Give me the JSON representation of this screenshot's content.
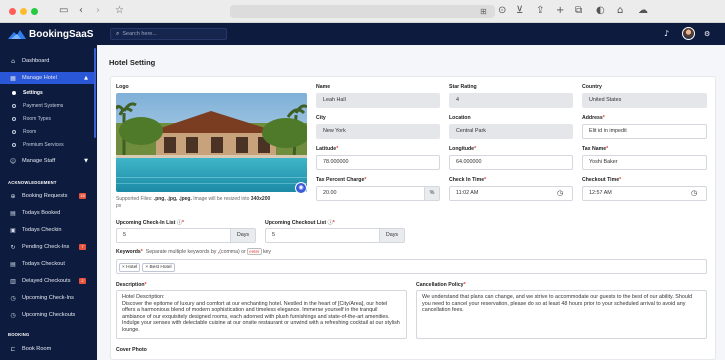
{
  "browser": {
    "icons": [
      "sidebar-toggle-icon",
      "back-icon",
      "forward-icon",
      "bookmark-star-icon",
      "translate-icon",
      "play-circle-icon",
      "download-icon",
      "share-icon",
      "new-tab-icon",
      "tabs-overview-icon",
      "shield-icon",
      "home-icon",
      "cloud-icon"
    ]
  },
  "header": {
    "brand": "BookingSaaS",
    "search_placeholder": "Search here...",
    "icons": [
      "bell-icon",
      "avatar",
      "gear-icon"
    ]
  },
  "sidebar": {
    "items": [
      {
        "icon": "home-icon",
        "label": "Dashboard"
      },
      {
        "icon": "building-icon",
        "label": "Manage Hotel"
      },
      {
        "icon": "users-icon",
        "label": "Manage Staff"
      },
      {
        "icon": "cart-icon",
        "label": "Booking Requests",
        "badge": "18"
      },
      {
        "icon": "calendar-icon",
        "label": "Todays Booked"
      },
      {
        "icon": "calendar-check-icon",
        "label": "Todays Checkin"
      },
      {
        "icon": "refresh-icon",
        "label": "Pending Check-Ins",
        "badge": "7"
      },
      {
        "icon": "calendar-icon",
        "label": "Todays Checkout"
      },
      {
        "icon": "calendar-x-icon",
        "label": "Delayed Checkouts",
        "badge": "2"
      },
      {
        "icon": "clock-icon",
        "label": "Upcoming Check-Ins"
      },
      {
        "icon": "clock-icon",
        "label": "Upcoming Checkouts"
      },
      {
        "icon": "door-icon",
        "label": "Book Room"
      }
    ],
    "submenu": [
      "Settings",
      "Payment Systems",
      "Room Types",
      "Room",
      "Premium Services"
    ],
    "sections": [
      "ACKNOWLEDGEMENT",
      "BOOKING"
    ]
  },
  "page": {
    "title": "Hotel Setting"
  },
  "form": {
    "logo_label": "Logo",
    "logo_hint_prefix": "Supported Files: ",
    "logo_hint_types": ".png, .jpg, .jpeg.",
    "logo_hint_mid": " Image will be resized into ",
    "logo_hint_size": "340x200",
    "logo_hint_suffix": "px",
    "name": {
      "label": "Name",
      "value": "Leah Hall"
    },
    "star_rating": {
      "label": "Star Rating",
      "value": "4"
    },
    "country": {
      "label": "Country",
      "value": "United States"
    },
    "city": {
      "label": "City",
      "value": "New York"
    },
    "location": {
      "label": "Location",
      "value": "Central Park"
    },
    "address": {
      "label": "Address",
      "value": "Elit id in impedit"
    },
    "latitude": {
      "label": "Latitude",
      "value": "78.000000"
    },
    "longitude": {
      "label": "Longitude",
      "value": "64.000000"
    },
    "tax_name": {
      "label": "Tax Name",
      "value": "Yoshi Baker"
    },
    "tax_percent": {
      "label": "Tax Percent Charge",
      "value": "20.00",
      "addon": "%"
    },
    "check_in_time": {
      "label": "Check In Time",
      "value": "11:02 AM"
    },
    "checkout_time": {
      "label": "Checkout Time",
      "value": "12:57 AM"
    },
    "upcoming_checkin": {
      "label": "Upcoming Check-In List",
      "value": "5",
      "addon": "Days"
    },
    "upcoming_checkout": {
      "label": "Upcoming Checkout List",
      "value": "5",
      "addon": "Days"
    },
    "keywords": {
      "label": "Keywords",
      "hint_a": "Separate multiple keywords by ",
      "hint_comma": ",",
      "hint_b": "(comma) or ",
      "hint_key": "enter",
      "hint_c": " key",
      "chips": [
        "Hotel",
        "Best Hotel"
      ]
    },
    "description": {
      "label": "Description",
      "value": "Hotel Description:\nDiscover the epitome of luxury and comfort at our enchanting hotel. Nestled in the heart of [City/Area], our hotel offers a harmonious blend of modern sophistication and timeless elegance. Immerse yourself in the tranquil ambiance of our exquisitely designed rooms, each adorned with plush furnishings and state-of-the-art amenities. Indulge your senses with delectable cuisine at our onsite restaurant or unwind with a refreshing cocktail at our stylish lounge."
    },
    "cancellation": {
      "label": "Cancellation Policy",
      "value": "We understand that plans can change, and we strive to accommodate our guests to the best of our ability. Should you need to cancel your reservation, please do so at least 48 hours prior to your scheduled arrival to avoid any cancellation fees."
    },
    "cover_photo_label": "Cover Photo"
  },
  "colors": {
    "sidebar_bg": "#0d1b3e",
    "accent": "#2a56d8",
    "badge": "#e5533d"
  }
}
